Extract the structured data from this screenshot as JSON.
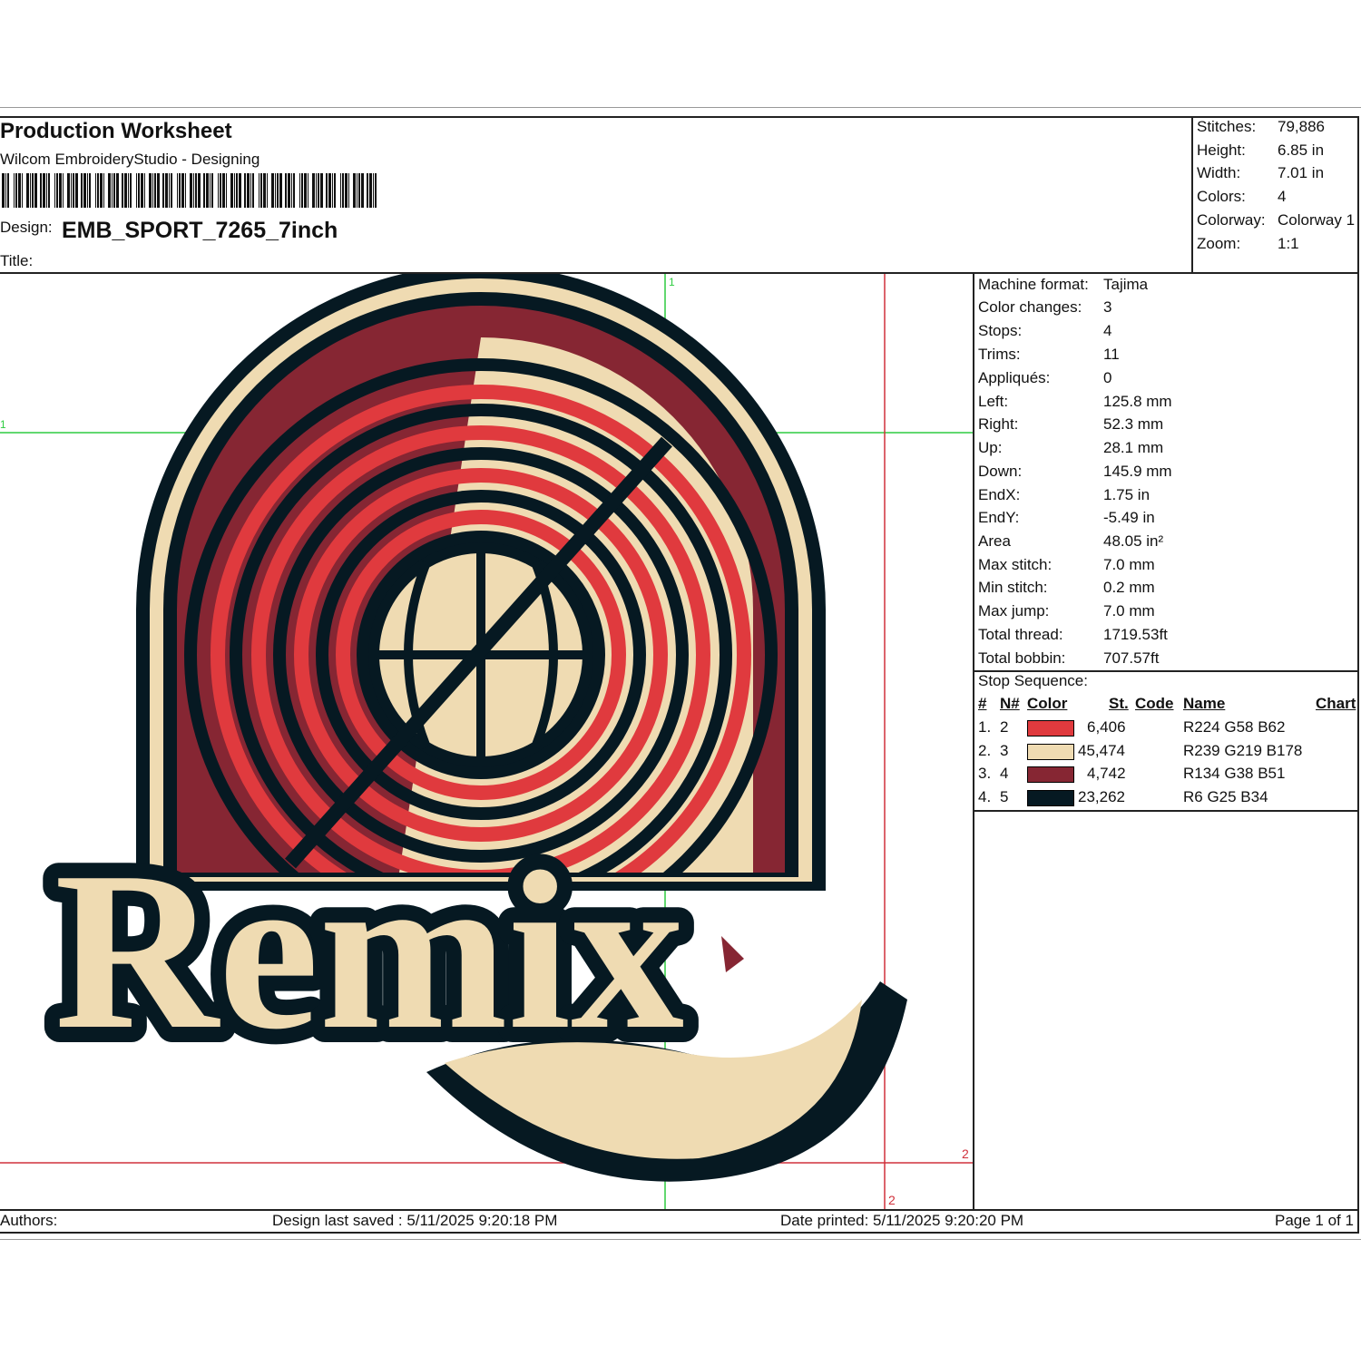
{
  "header": {
    "title": "Production Worksheet",
    "subtitle": "Wilcom EmbroideryStudio - Designing",
    "design_label": "Design:",
    "design_value": "EMB_SPORT_7265_7inch",
    "title_label": "Title:"
  },
  "summary": [
    {
      "label": "Stitches:",
      "value": "79,886"
    },
    {
      "label": "Height:",
      "value": "6.85 in"
    },
    {
      "label": "Width:",
      "value": "7.01 in"
    },
    {
      "label": "Colors:",
      "value": "4"
    },
    {
      "label": "Colorway:",
      "value": "Colorway 1"
    },
    {
      "label": "Zoom:",
      "value": "1:1"
    }
  ],
  "machine_info": [
    {
      "label": "Machine format:",
      "value": "Tajima"
    },
    {
      "label": "Color changes:",
      "value": "3"
    },
    {
      "label": "Stops:",
      "value": "4"
    },
    {
      "label": "Trims:",
      "value": "11"
    },
    {
      "label": "Appliqués:",
      "value": "0"
    },
    {
      "label": "Left:",
      "value": "125.8 mm"
    },
    {
      "label": "Right:",
      "value": "52.3 mm"
    },
    {
      "label": "Up:",
      "value": "28.1 mm"
    },
    {
      "label": "Down:",
      "value": "145.9 mm"
    },
    {
      "label": "EndX:",
      "value": "1.75 in"
    },
    {
      "label": "EndY:",
      "value": "-5.49 in"
    },
    {
      "label": "Area",
      "value": " 48.05 in²"
    },
    {
      "label": "Max stitch:",
      "value": "7.0 mm"
    },
    {
      "label": "Min stitch:",
      "value": "0.2 mm"
    },
    {
      "label": "Max jump:",
      "value": "7.0 mm"
    },
    {
      "label": "Total thread:",
      "value": "1719.53ft"
    },
    {
      "label": "Total bobbin:",
      "value": "707.57ft"
    }
  ],
  "stop_sequence": {
    "title": "Stop Sequence:",
    "columns": [
      "#",
      "N#",
      "Color",
      "St.",
      "Code",
      "Name",
      "Chart"
    ],
    "rows": [
      {
        "num": "1.",
        "n": "2",
        "color": "#e03a3e",
        "stitches": "6,406",
        "code": "",
        "name": "R224 G58 B62",
        "chart": ""
      },
      {
        "num": "2.",
        "n": "3",
        "color": "#efdbb2",
        "stitches": "45,474",
        "code": "",
        "name": "R239 G219 B178",
        "chart": ""
      },
      {
        "num": "3.",
        "n": "4",
        "color": "#862633",
        "stitches": "4,742",
        "code": "",
        "name": "R134 G38 B51",
        "chart": ""
      },
      {
        "num": "4.",
        "n": "5",
        "color": "#061922",
        "stitches": "23,262",
        "code": "",
        "name": "R6 G25 B34",
        "chart": ""
      }
    ]
  },
  "canvas": {
    "guide_labels": [
      "1",
      "1",
      "2",
      "2"
    ],
    "design_text": "Remix",
    "colors": {
      "red": "#e03a3e",
      "cream": "#efdbb2",
      "maroon": "#862633",
      "navy": "#061922"
    }
  },
  "footer": {
    "authors": "Authors:",
    "last_saved": "Design last saved : 5/11/2025 9:20:18 PM",
    "printed": "Date printed: 5/11/2025 9:20:20 PM",
    "page": "Page 1 of 1"
  }
}
